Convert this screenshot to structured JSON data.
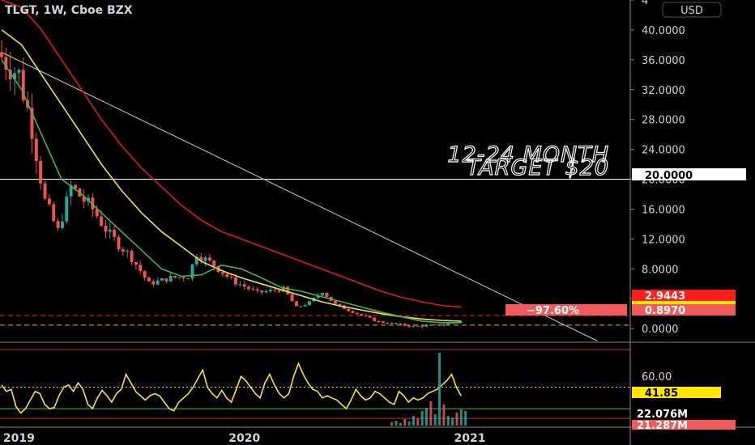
{
  "header": {
    "symbol_line": "TLGT, 1W, Cboe BZX",
    "currency_button": "USD"
  },
  "annotation": {
    "line1": "12-24 MONTH",
    "line2": "TARGET $20"
  },
  "colors": {
    "background": "#000000",
    "ema_long": "#e01b1b",
    "ema_mid": "#f0e442",
    "ema_short": "#4caf50",
    "candle_up": "#26a69a",
    "candle_down": "#ef5350",
    "rsi": "#f5e342",
    "tag_red": "#ff1e1e",
    "tag_pct": "#f05a5a",
    "tag_yellow": "#ffe600",
    "tag_white": "#ffffff",
    "tag_volume": "#f05a5a",
    "tag_green": "#2ecc71"
  },
  "price_tags": {
    "target": "20.0000",
    "ema_long": "2.9443",
    "current": "0.8970",
    "change_pct": "−97.60%",
    "rsi_value": "41.85",
    "vol_ma": "22.076M",
    "vol": "21.287M"
  },
  "chart_data": [
    {
      "type": "candlestick",
      "title": "TLGT, 1W, Cboe BZX",
      "x_ticks": [
        "2019",
        "2020",
        "2021"
      ],
      "y_ticks": [
        "4",
        "40.0000",
        "36.0000",
        "32.0000",
        "28.0000",
        "24.0000",
        "20.0000",
        "16.0000",
        "12.0000",
        "8.0000",
        "4.0000",
        "0.0000"
      ],
      "ylim": [
        -1.5,
        44
      ],
      "horizontal_line": 20,
      "points": [
        {
          "week": 0,
          "close": 37
        },
        {
          "week": 5,
          "close": 34
        },
        {
          "week": 8,
          "close": 27
        },
        {
          "week": 11,
          "close": 17
        },
        {
          "week": 14,
          "close": 13
        },
        {
          "week": 17,
          "close": 19
        },
        {
          "week": 22,
          "close": 16
        },
        {
          "week": 26,
          "close": 12.5
        },
        {
          "week": 31,
          "close": 9.5
        },
        {
          "week": 35,
          "close": 6
        },
        {
          "week": 40,
          "close": 6.8
        },
        {
          "week": 44,
          "close": 7
        },
        {
          "week": 46,
          "close": 10
        },
        {
          "week": 50,
          "close": 8.5
        },
        {
          "week": 54,
          "close": 6.5
        },
        {
          "week": 60,
          "close": 4.8
        },
        {
          "week": 66,
          "close": 5.3
        },
        {
          "week": 69,
          "close": 2.8
        },
        {
          "week": 72,
          "close": 3.5
        },
        {
          "week": 75,
          "close": 5
        },
        {
          "week": 78,
          "close": 3.2
        },
        {
          "week": 83,
          "close": 2
        },
        {
          "week": 88,
          "close": 0.9
        },
        {
          "week": 96,
          "close": 0.3
        },
        {
          "week": 102,
          "close": 0.5
        },
        {
          "week": 106,
          "close": 0.9
        }
      ],
      "series": [
        {
          "values": [
            40,
            38,
            34,
            30,
            26,
            22,
            18.5,
            15.5,
            13,
            11,
            9,
            7.8,
            6.8,
            6,
            5.2,
            4.4,
            3.6,
            3,
            2.5,
            2,
            1.6,
            1.3,
            1.1,
            1
          ]
        },
        {
          "values": [
            36,
            32,
            26,
            20,
            18,
            15.5,
            13,
            10.5,
            8,
            7,
            7.2,
            8.5,
            8,
            6.8,
            5.5,
            5,
            4.3,
            3.6,
            2.9,
            2.2,
            1.6,
            1,
            0.8,
            0.8
          ]
        },
        {
          "values": [
            44,
            43,
            40,
            36,
            32,
            28,
            24.5,
            21.5,
            19,
            16.5,
            14.5,
            13,
            12,
            11,
            10,
            9,
            8,
            7,
            6,
            5,
            4.2,
            3.6,
            3.1,
            2.9
          ]
        }
      ],
      "trendline": {
        "from": [
          0,
          37
        ],
        "to": [
          115,
          -1
        ]
      },
      "last_values": {
        "price": 0.897,
        "ema_long": 2.9443
      }
    },
    {
      "type": "line",
      "y_ticks": [
        "60.00"
      ],
      "ylim": [
        15,
        85
      ],
      "levels": [
        70,
        50,
        30
      ],
      "series": [
        {
          "values": [
            52,
            46,
            48,
            32,
            26,
            30,
            38,
            46,
            44,
            34,
            30,
            31,
            42,
            50,
            52,
            46,
            54,
            48,
            34,
            30,
            40,
            47,
            42,
            36,
            44,
            48,
            62,
            54,
            46,
            42,
            38,
            42,
            44,
            42,
            36,
            30,
            28,
            36,
            40,
            44,
            50,
            58,
            66,
            50,
            44,
            40,
            47,
            40,
            36,
            48,
            60,
            56,
            50,
            44,
            40,
            54,
            62,
            52,
            44,
            40,
            44,
            60,
            72,
            62,
            54,
            48,
            46,
            40,
            42,
            40,
            38,
            34,
            30,
            38,
            48,
            42,
            38,
            40,
            46,
            44,
            40,
            36,
            34,
            46,
            42,
            36,
            40,
            38,
            40,
            44,
            46,
            48,
            52,
            56,
            62,
            50,
            41.85
          ]
        }
      ]
    }
  ]
}
